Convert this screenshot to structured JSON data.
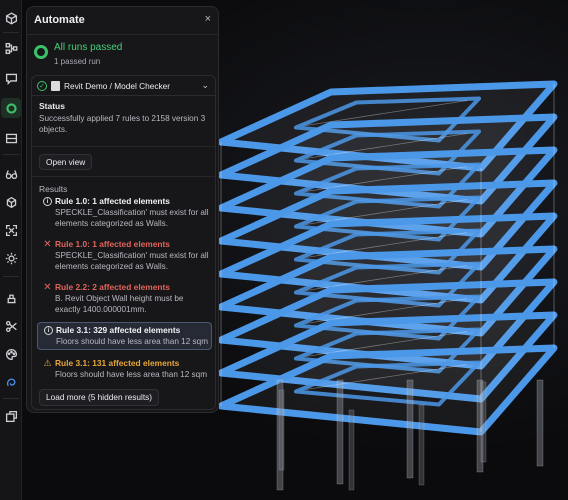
{
  "toolbar": {
    "items": [
      {
        "icon": "cube-icon"
      },
      {
        "icon": "node-graph-icon"
      },
      {
        "icon": "comment-icon"
      },
      {
        "icon": "automate-icon"
      },
      {
        "icon": "layers-icon"
      },
      {
        "icon": "glasses-icon"
      },
      {
        "icon": "explode-icon"
      },
      {
        "icon": "zoom-extents-icon"
      },
      {
        "icon": "sun-icon"
      },
      {
        "icon": "measure-icon"
      },
      {
        "icon": "scissors-icon"
      },
      {
        "icon": "palette-icon"
      },
      {
        "icon": "speckle-icon"
      },
      {
        "icon": "sections-icon"
      }
    ]
  },
  "panel": {
    "title": "Automate",
    "close": "×",
    "summary": {
      "title": "All runs passed",
      "subtitle": "1 passed run"
    },
    "run": {
      "name": "Revit Demo / Model Checker",
      "status_label": "Status",
      "status_text": "Successfully applied 7 rules to 2158 version 3 objects.",
      "open_view": "Open view",
      "results_label": "Results",
      "rules": [
        {
          "title": "Rule 1.0: 1 affected elements",
          "desc": "SPECKLE_Classification' must exist for all elements categorized as Walls.",
          "level": "info"
        },
        {
          "title": "Rule 1.0: 1 affected elements",
          "desc": "SPECKLE_Classification' must exist for all elements categorized as Walls.",
          "level": "error"
        },
        {
          "title": "Rule 2.2: 2 affected elements",
          "desc": "B. Revit Object Wall height must be exactly 1400.000001mm.",
          "level": "error"
        },
        {
          "title": "Rule 3.1: 329 affected elements",
          "desc": "Floors should have less area than 12 sqm",
          "level": "info"
        },
        {
          "title": "Rule 3.1: 131 affected elements",
          "desc": "Floors should have less area than 12 sqm",
          "level": "warning"
        }
      ],
      "load_more": "Load more (5 hidden results)"
    }
  },
  "colors": {
    "success": "#3ac26b",
    "error": "#e0645a",
    "warning": "#e8a737",
    "slab": "#4c98e8",
    "background": "#0b0b0d"
  }
}
